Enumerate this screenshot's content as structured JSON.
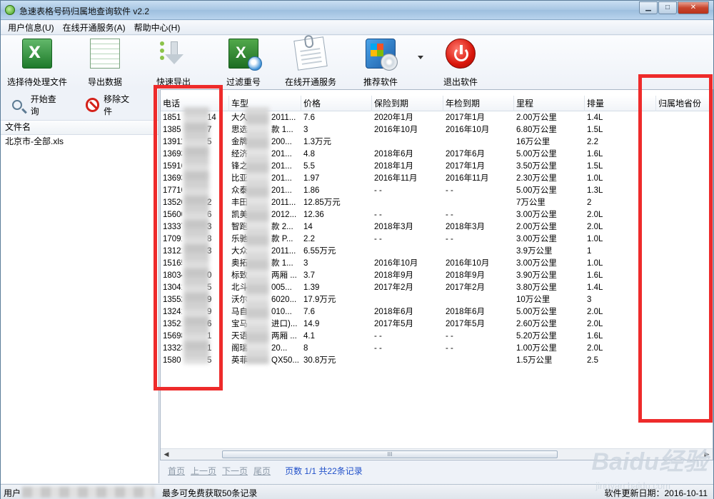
{
  "app": {
    "title": "急速表格号码归属地查询软件 v2.2"
  },
  "window_controls": {
    "minimize": "▁",
    "maximize": "□",
    "close": "✕"
  },
  "menu": [
    {
      "label": "用户信息(U)"
    },
    {
      "label": "在线开通服务(A)"
    },
    {
      "label": "帮助中心(H)"
    }
  ],
  "toolbar": {
    "select_file": "选择待处理文件",
    "export_data": "导出数据",
    "quick_export": "快速导出",
    "filter_dup": "过滤重号",
    "online_service": "在线开通服务",
    "recommend": "推荐软件",
    "exit": "退出软件"
  },
  "side": {
    "start_query": "开始查询",
    "remove_file": "移除文件",
    "file_header": "文件名",
    "files": [
      "北京市-全部.xls"
    ]
  },
  "grid": {
    "columns": [
      "电话",
      "车型",
      "价格",
      "保险到期",
      "年检到期",
      "里程",
      "排量",
      "归属地省份"
    ],
    "rows": [
      [
        "1851",
        "14",
        "大久",
        "2011...",
        "7.6",
        "2020年1月",
        "2017年1月",
        "2.00万公里",
        "1.4L"
      ],
      [
        "1385",
        "7",
        "思选",
        "款 1...",
        "3",
        "2016年10月",
        "2016年10月",
        "6.80万公里",
        "1.5L"
      ],
      [
        "13911",
        "5",
        "金牌",
        "200...",
        "1.3万元",
        "",
        "",
        "16万公里",
        "2.2"
      ],
      [
        "13693",
        "",
        "经济",
        "201...",
        "4.8",
        "2018年6月",
        "2017年6月",
        "5.00万公里",
        "1.6L"
      ],
      [
        "15916",
        "",
        "锋之",
        "201...",
        "5.5",
        "2018年1月",
        "2017年1月",
        "3.50万公里",
        "1.5L"
      ],
      [
        "13693",
        "",
        "比亚",
        "201...",
        "1.97",
        "2016年11月",
        "2016年11月",
        "2.30万公里",
        "1.0L"
      ],
      [
        "17710",
        "",
        "众泰",
        "201...",
        "1.86",
        "- -",
        "- -",
        "5.00万公里",
        "1.3L"
      ],
      [
        "13520",
        "2",
        "丰田",
        "2011...",
        "12.85万元",
        "",
        "",
        "7万公里",
        "2"
      ],
      [
        "15600",
        "6",
        "凯美",
        "2012...",
        "12.36",
        "- -",
        "- -",
        "3.00万公里",
        "2.0L"
      ],
      [
        "13337",
        "3",
        "智跑",
        "款 2...",
        "14",
        "2018年3月",
        "2018年3月",
        "2.00万公里",
        "2.0L"
      ],
      [
        "17091",
        "8",
        "乐驰",
        "款 P...",
        "2.2",
        "- -",
        "- -",
        "3.00万公里",
        "1.0L"
      ],
      [
        "13121",
        "3",
        "大众",
        "2011...",
        "6.55万元",
        "",
        "",
        "3.9万公里",
        "1"
      ],
      [
        "15165",
        "",
        "奥拓",
        "款 1...",
        "3",
        "2016年10月",
        "2016年10月",
        "3.00万公里",
        "1.0L"
      ],
      [
        "18034",
        "0",
        "标致",
        "两厢 ...",
        "3.7",
        "2018年9月",
        "2018年9月",
        "3.90万公里",
        "1.6L"
      ],
      [
        "13041",
        "5",
        "北斗",
        "005...",
        "1.39",
        "2017年2月",
        "2017年2月",
        "3.80万公里",
        "1.4L"
      ],
      [
        "13552",
        "9",
        "沃尔",
        "6020...",
        "17.9万元",
        "",
        "",
        "10万公里",
        "3"
      ],
      [
        "13241",
        "9",
        "马自",
        "010...",
        "7.6",
        "2018年6月",
        "2018年6月",
        "5.00万公里",
        "2.0L"
      ],
      [
        "13521",
        "6",
        "宝马",
        "进口)...",
        "14.9",
        "2017年5月",
        "2017年5月",
        "2.60万公里",
        "2.0L"
      ],
      [
        "15698",
        "1",
        "天语",
        "两厢 ...",
        "4.1",
        "- -",
        "- -",
        "5.20万公里",
        "1.6L"
      ],
      [
        "13323",
        "1",
        "阁瑞",
        "20...",
        "8",
        "- -",
        "- -",
        "1.00万公里",
        "2.0L"
      ],
      [
        "1580",
        "5",
        "英菲",
        "QX50...",
        "30.8万元",
        "",
        "",
        "1.5万公里",
        "2.5"
      ]
    ],
    "scroll_grip": "III"
  },
  "pager": {
    "first": "首页",
    "prev": "上一页",
    "next": "下一页",
    "last": "尾页",
    "info": "页数 1/1 共22条记录"
  },
  "status": {
    "user": "用户",
    "left": "最多可免费获取50条记录",
    "right": "软件更新日期：2016-10-11"
  },
  "watermark": {
    "brand": "Baidu经验",
    "url": "jingyan.baidu.com"
  },
  "colors": {
    "highlight_box": "#ee2b2b",
    "pager_info": "#1f4fc9"
  }
}
